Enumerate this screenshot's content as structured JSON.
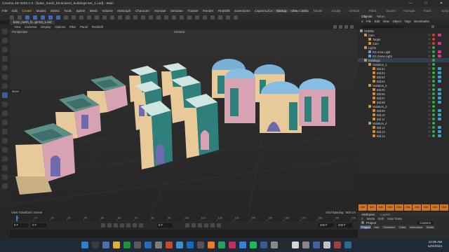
{
  "window": {
    "title": "Cinema 4D 2025.1.0 - [base_mesh_kit-ancient_buildings-set_1.c4d] - Main",
    "controls": [
      "—",
      "□",
      "✕"
    ]
  },
  "menubar": {
    "items": [
      "File",
      "Edit",
      "Create",
      "Modes",
      "Select",
      "Tools",
      "Spline",
      "Mesh",
      "Volume",
      "MoGraph",
      "Character",
      "Animate",
      "Simulate",
      "Tracker",
      "Render",
      "Redshift",
      "Extensions",
      "Скрипты/Скрипты",
      "Window",
      "Help"
    ],
    "active": "Create"
  },
  "layouts": {
    "items": [
      "Startup",
      "Standard",
      "Model",
      "Sculpt",
      "UVEdit",
      "Paint",
      "Groom",
      "Animate",
      "Track",
      "Script",
      "Nodes"
    ],
    "active": "Startup"
  },
  "document": {
    "tab": "base_mesh_ki...gs-set_1.c4d"
  },
  "viewport": {
    "menu": [
      "View",
      "Cameras",
      "Display",
      "Options",
      "Filter",
      "Panel",
      "Redshift"
    ],
    "label": "Perspective",
    "camera": "Camera",
    "move_label": "Move",
    "bottom_left": "View Transform: Scene",
    "bottom_right": "Grid Spacing : 500 cm"
  },
  "timeline": {
    "ticks": [
      "0",
      "10",
      "20",
      "30",
      "40",
      "50",
      "60",
      "70",
      "80",
      "90",
      "100",
      "110",
      "120",
      "130",
      "140",
      "150",
      "160",
      "170",
      "180",
      "190",
      "200"
    ],
    "current_frame": "0 F",
    "start": "0 F",
    "end": "0 F",
    "min": "200 F",
    "max": "200 F",
    "fps": "0 F"
  },
  "objects_panel": {
    "tabs": [
      "Objects",
      "Takes"
    ],
    "menu": [
      "≡",
      "File",
      "Edit",
      "View",
      "Object",
      "Tags",
      "Bookmarks"
    ],
    "rows": [
      {
        "label": "SCENE",
        "indent": 0,
        "color": "#9a9a9a",
        "dot": "",
        "tag": ""
      },
      {
        "label": "Cam",
        "indent": 1,
        "color": "#c79a4a",
        "dot": "#d43a3a",
        "tag": "#d6398a"
      },
      {
        "label": "Target",
        "indent": 2,
        "color": "#c79a4a",
        "dot": "#d43a3a",
        "tag": ""
      },
      {
        "label": "Cam",
        "indent": 2,
        "color": "#c79a4a",
        "dot": "#d43a3a",
        "tag": "#d6398a"
      },
      {
        "label": "Lights",
        "indent": 1,
        "color": "#c79a4a",
        "dot": "#2fb04b",
        "tag": ""
      },
      {
        "label": "RS Area Light",
        "indent": 2,
        "color": "#6aa0d8",
        "dot": "#2fb04b",
        "tag": "#d6398a"
      },
      {
        "label": "RS Dome Light",
        "indent": 2,
        "color": "#6aa0d8",
        "dot": "#2fb04b",
        "tag": "#d6398a"
      },
      {
        "label": "Buildings",
        "indent": 1,
        "color": "#c79a4a",
        "dot": "#2fb04b",
        "tag": ""
      },
      {
        "label": "Variation_1",
        "indent": 2,
        "color": "#c79a4a",
        "dot": "#2fb04b",
        "tag": ""
      },
      {
        "label": "Bld.01",
        "indent": 3,
        "color": "#e08a2a",
        "dot": "#2fb04b",
        "tag": "#3aa0c8"
      },
      {
        "label": "Bld.02",
        "indent": 3,
        "color": "#e08a2a",
        "dot": "#2fb04b",
        "tag": "#3aa0c8"
      },
      {
        "label": "Bld.03",
        "indent": 3,
        "color": "#e08a2a",
        "dot": "#2fb04b",
        "tag": "#3aa0c8"
      },
      {
        "label": "Bld.04",
        "indent": 3,
        "color": "#e08a2a",
        "dot": "#2fb04b",
        "tag": "#3aa0c8"
      },
      {
        "label": "Variation_2",
        "indent": 2,
        "color": "#c79a4a",
        "dot": "#2fb04b",
        "tag": ""
      },
      {
        "label": "Bld.05",
        "indent": 3,
        "color": "#e08a2a",
        "dot": "#2fb04b",
        "tag": "#3aa0c8"
      },
      {
        "label": "Bld.06",
        "indent": 3,
        "color": "#e08a2a",
        "dot": "#2fb04b",
        "tag": "#3aa0c8"
      },
      {
        "label": "Bld.07",
        "indent": 3,
        "color": "#e08a2a",
        "dot": "#2fb04b",
        "tag": "#3aa0c8"
      },
      {
        "label": "Bld.08",
        "indent": 3,
        "color": "#e08a2a",
        "dot": "#2fb04b",
        "tag": "#3aa0c8"
      },
      {
        "label": "Variation_3",
        "indent": 2,
        "color": "#c79a4a",
        "dot": "#2fb04b",
        "tag": ""
      },
      {
        "label": "Bld.09",
        "indent": 3,
        "color": "#e08a2a",
        "dot": "#2fb04b",
        "tag": "#3aa0c8"
      },
      {
        "label": "Bld.10",
        "indent": 3,
        "color": "#e08a2a",
        "dot": "#2fb04b",
        "tag": "#3aa0c8"
      },
      {
        "label": "Bld.11",
        "indent": 3,
        "color": "#e08a2a",
        "dot": "#2fb04b",
        "tag": "#3aa0c8"
      },
      {
        "label": "Variation_4",
        "indent": 2,
        "color": "#c79a4a",
        "dot": "#2fb04b",
        "tag": ""
      },
      {
        "label": "Bld.12",
        "indent": 3,
        "color": "#e08a2a",
        "dot": "#2fb04b",
        "tag": "#3aa0c8"
      },
      {
        "label": "Bld.13",
        "indent": 3,
        "color": "#e08a2a",
        "dot": "#2fb04b",
        "tag": "#3aa0c8"
      },
      {
        "label": "Bld.14",
        "indent": 3,
        "color": "#e08a2a",
        "dot": "#2fb04b",
        "tag": "#3aa0c8"
      }
    ]
  },
  "materials": {
    "items": [
      "Mat",
      "Mat",
      "Mat",
      "Mat",
      "Mat",
      "Mat",
      "Mat",
      "Mat",
      "Mat",
      "Mat"
    ]
  },
  "attributes": {
    "title": "Attributes",
    "tabs": [
      "Layers"
    ],
    "menu": [
      "≡",
      "Mode",
      "Edit",
      "User Data"
    ],
    "object": "Project",
    "mode": "Custom",
    "subtabs": [
      "Project",
      "Info",
      "Cineware",
      "Xrefs",
      "Animation",
      "Bullet"
    ],
    "active_subtab": "Project"
  },
  "taskbar": {
    "time": "12:05 AM",
    "date": "12/4/2024"
  }
}
